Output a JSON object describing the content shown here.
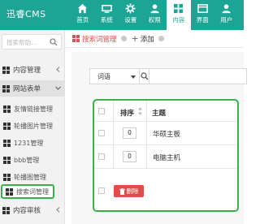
{
  "app": {
    "title": "迅睿CMS"
  },
  "topnav": [
    {
      "label": "首页",
      "icon": "home-icon"
    },
    {
      "label": "系统",
      "icon": "system-icon"
    },
    {
      "label": "设置",
      "icon": "settings-icon"
    },
    {
      "label": "权限",
      "icon": "permission-icon"
    },
    {
      "label": "内容",
      "icon": "content-icon",
      "active": true
    },
    {
      "label": "界面",
      "icon": "interface-icon"
    },
    {
      "label": "用户",
      "icon": "user-icon"
    }
  ],
  "sidebar": {
    "search_placeholder": "搜索帮助...",
    "groups": [
      {
        "label": "内容管理",
        "open": false
      },
      {
        "label": "网站表单",
        "open": true
      },
      {
        "label": "内容审核",
        "open": false
      }
    ],
    "items": [
      {
        "label": "友情链接管理"
      },
      {
        "label": "轮播图片管理"
      },
      {
        "label": "1231管理"
      },
      {
        "label": "bbb管理"
      },
      {
        "label": "轮播图管理"
      },
      {
        "label": "搜索词管理",
        "active": true
      }
    ]
  },
  "tabs": [
    {
      "label": "搜索词管理",
      "active": true
    },
    {
      "label": "添加"
    }
  ],
  "filter": {
    "field_select": "词语"
  },
  "table": {
    "headers": {
      "sort": "排序",
      "title": "主题"
    },
    "rows": [
      {
        "sort": "0",
        "title": "华硕主板"
      },
      {
        "sort": "0",
        "title": "电脑主机"
      }
    ],
    "delete_label": "删除"
  },
  "colors": {
    "accent": "#1ca594",
    "danger": "#e04c4c",
    "highlight": "#35b34a"
  }
}
